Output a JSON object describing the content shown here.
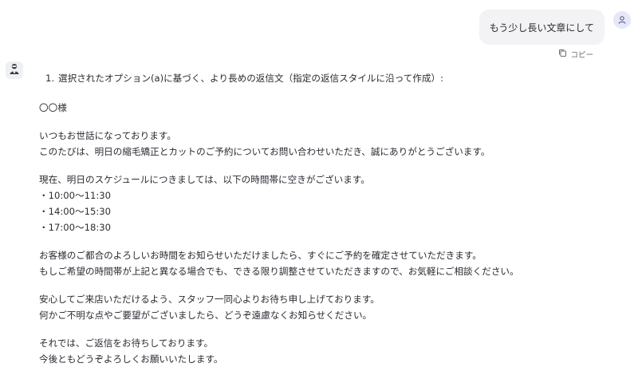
{
  "user_message": {
    "text": "もう少し長い文章にして",
    "copy_label": "コピー"
  },
  "assistant_message": {
    "list_number": "1.",
    "list_item": "選択されたオプション(a)に基づく、より長めの返信文（指定の返信スタイルに沿って作成）:",
    "paragraphs": [
      [
        "〇〇様"
      ],
      [
        "いつもお世話になっております。",
        "このたびは、明日の縮毛矯正とカットのご予約についてお問い合わせいただき、誠にありがとうございます。"
      ],
      [
        "現在、明日のスケジュールにつきましては、以下の時間帯に空きがございます。",
        "・10:00〜11:30",
        "・14:00〜15:30",
        "・17:00〜18:30"
      ],
      [
        "お客様のご都合のよろしいお時間をお知らせいただけましたら、すぐにご予約を確定させていただきます。",
        "もしご希望の時間帯が上記と異なる場合でも、できる限り調整させていただきますので、お気軽にご相談ください。"
      ],
      [
        "安心してご来店いただけるよう、スタッフ一同心よりお待ち申し上げております。",
        "何かご不明な点やご要望がございましたら、どうぞ遠慮なくお知らせください。"
      ],
      [
        "それでは、ご返信をお待ちしております。",
        "今後ともどうぞよろしくお願いいたします。"
      ]
    ]
  },
  "icons": {
    "user_avatar": "user-icon",
    "copy": "copy-icon",
    "assistant_avatar": "assistant-avatar-icon"
  },
  "colors": {
    "user_bubble_bg": "#f3f3f5",
    "user_avatar_bg": "#e6e7f7",
    "text": "#2b2b33",
    "muted": "#6b6b75"
  }
}
